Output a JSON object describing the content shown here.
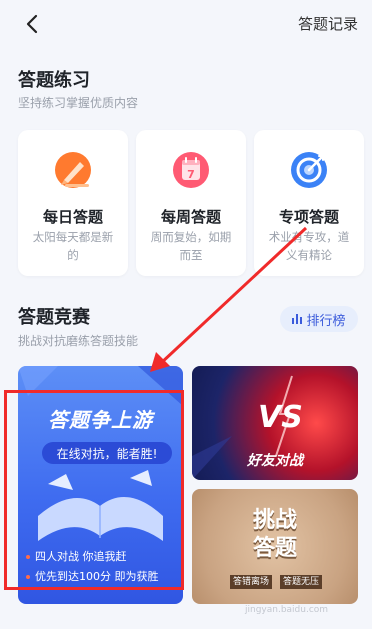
{
  "header": {
    "record_label": "答题记录"
  },
  "practice": {
    "title": "答题练习",
    "subtitle": "坚持练习掌握优质内容",
    "cards": [
      {
        "title": "每日答题",
        "desc": "太阳每天都是新的"
      },
      {
        "title": "每周答题",
        "desc": "周而复始，如期而至"
      },
      {
        "title": "专项答题",
        "desc": "术业有专攻，道义有精论"
      }
    ]
  },
  "contest": {
    "title": "答题竞赛",
    "subtitle": "挑战对抗磨练答题技能",
    "rank_label": "排行榜",
    "banner_main": {
      "title": "答题争上游",
      "subtitle": "在线对抗，能者胜!",
      "lines": [
        "四人对战 你追我赶",
        "优先到达100分 即为获胜"
      ]
    },
    "banner_friend": {
      "vs": "VS",
      "title": "好友对战"
    },
    "banner_challenge": {
      "title_top": "挑战",
      "title_bottom": "答题",
      "tags": [
        "答错离场",
        "答题无压"
      ]
    }
  },
  "watermark": "jingyan.baidu.com",
  "colors": {
    "accent": "#3b5bdb",
    "highlight": "#f02a2a",
    "background": "#f4f6fb"
  }
}
